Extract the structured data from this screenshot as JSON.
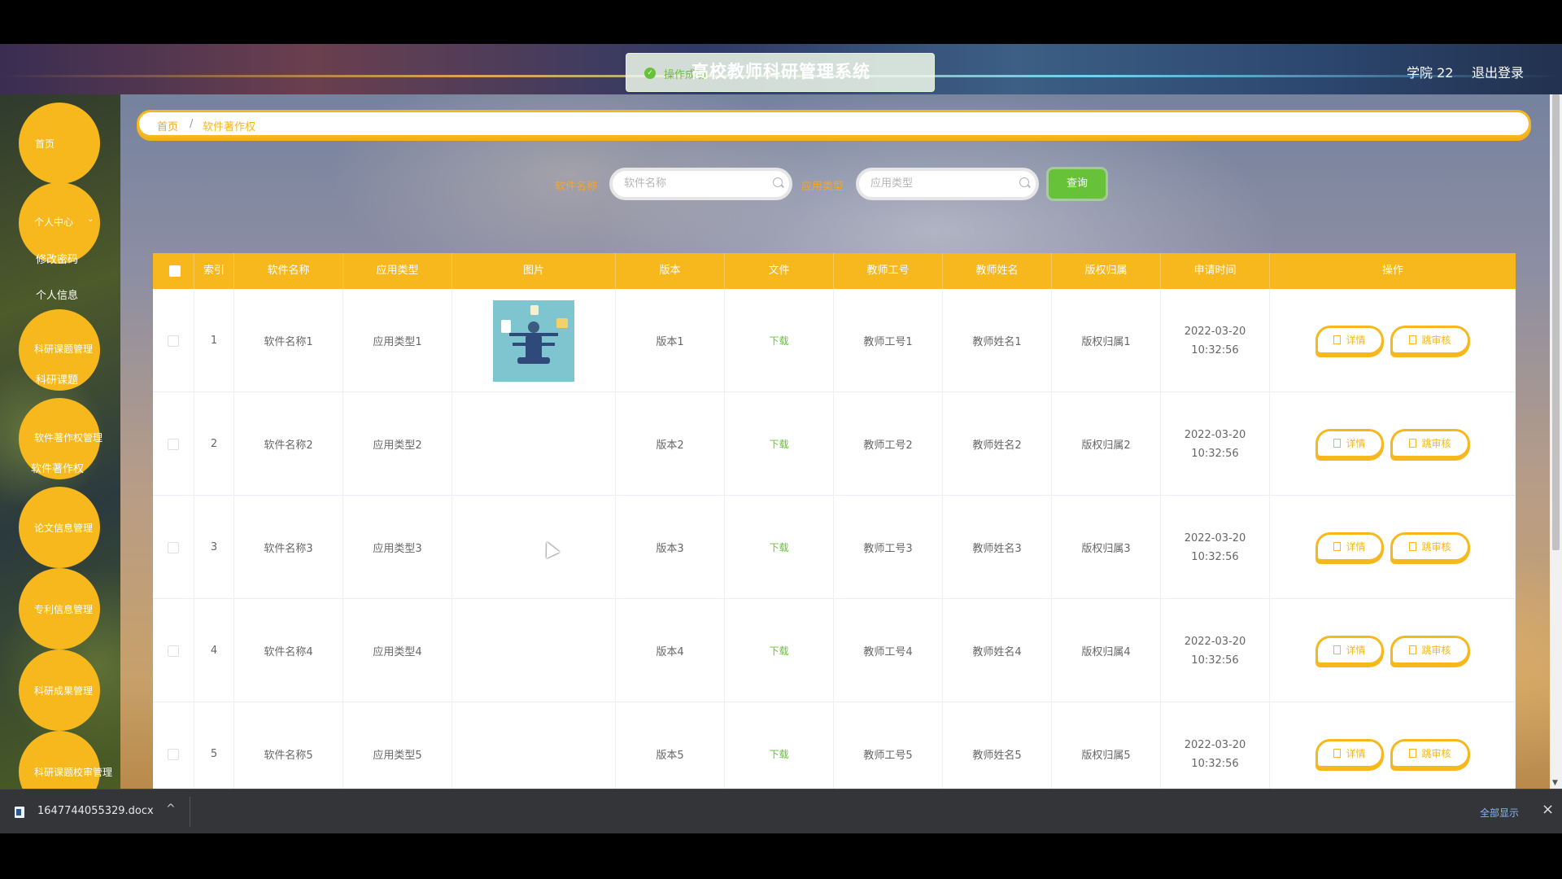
{
  "header": {
    "app_title": "高校教师科研管理系统",
    "toast_text": "操作成功",
    "user_name": "学院 22",
    "logout_label": "退出登录"
  },
  "sidebar": {
    "home": "首页",
    "personal_center": "个人中心",
    "change_password": "修改密码",
    "personal_info": "个人信息",
    "research_topic_mgmt": "科研课题管理",
    "research_topic": "科研课题",
    "software_copyright_mgmt": "软件著作权管理",
    "software_copyright": "软件著作权",
    "paper_info_mgmt": "论文信息管理",
    "patent_info_mgmt": "专利信息管理",
    "research_result_mgmt": "科研成果管理",
    "topic_review_mgmt": "科研课题校审管理"
  },
  "breadcrumb": {
    "home": "首页",
    "separator": "/",
    "current": "软件著作权"
  },
  "search": {
    "software_name_label": "软件名称",
    "software_name_placeholder": "软件名称",
    "app_type_label": "应用类型",
    "app_type_placeholder": "应用类型",
    "query_label": "查询"
  },
  "table": {
    "headers": [
      "索引",
      "软件名称",
      "应用类型",
      "图片",
      "版本",
      "文件",
      "教师工号",
      "教师姓名",
      "版权归属",
      "申请时间",
      "操作"
    ],
    "detail_label": "详情",
    "review_label": "跳审核",
    "download_label": "下载",
    "rows": [
      {
        "index": "1",
        "name": "软件名称1",
        "type": "应用类型1",
        "version": "版本1",
        "teacher_id": "教师工号1",
        "teacher_name": "教师姓名1",
        "owner": "版权归属1",
        "time": "2022-03-20 10:32:56"
      },
      {
        "index": "2",
        "name": "软件名称2",
        "type": "应用类型2",
        "version": "版本2",
        "teacher_id": "教师工号2",
        "teacher_name": "教师姓名2",
        "owner": "版权归属2",
        "time": "2022-03-20 10:32:56"
      },
      {
        "index": "3",
        "name": "软件名称3",
        "type": "应用类型3",
        "version": "版本3",
        "teacher_id": "教师工号3",
        "teacher_name": "教师姓名3",
        "owner": "版权归属3",
        "time": "2022-03-20 10:32:56"
      },
      {
        "index": "4",
        "name": "软件名称4",
        "type": "应用类型4",
        "version": "版本4",
        "teacher_id": "教师工号4",
        "teacher_name": "教师姓名4",
        "owner": "版权归属4",
        "time": "2022-03-20 10:32:56"
      },
      {
        "index": "5",
        "name": "软件名称5",
        "type": "应用类型5",
        "version": "版本5",
        "teacher_id": "教师工号5",
        "teacher_name": "教师姓名5",
        "owner": "版权归属5",
        "time": "2022-03-20 10:32:56"
      }
    ]
  },
  "download_bar": {
    "file_name": "1647744055329.docx",
    "show_all": "全部显示",
    "close_icon": "×",
    "chevron_icon": "^"
  },
  "colors": {
    "accent": "#f6b81d",
    "success": "#67c23a",
    "link": "#8ab4f8"
  }
}
